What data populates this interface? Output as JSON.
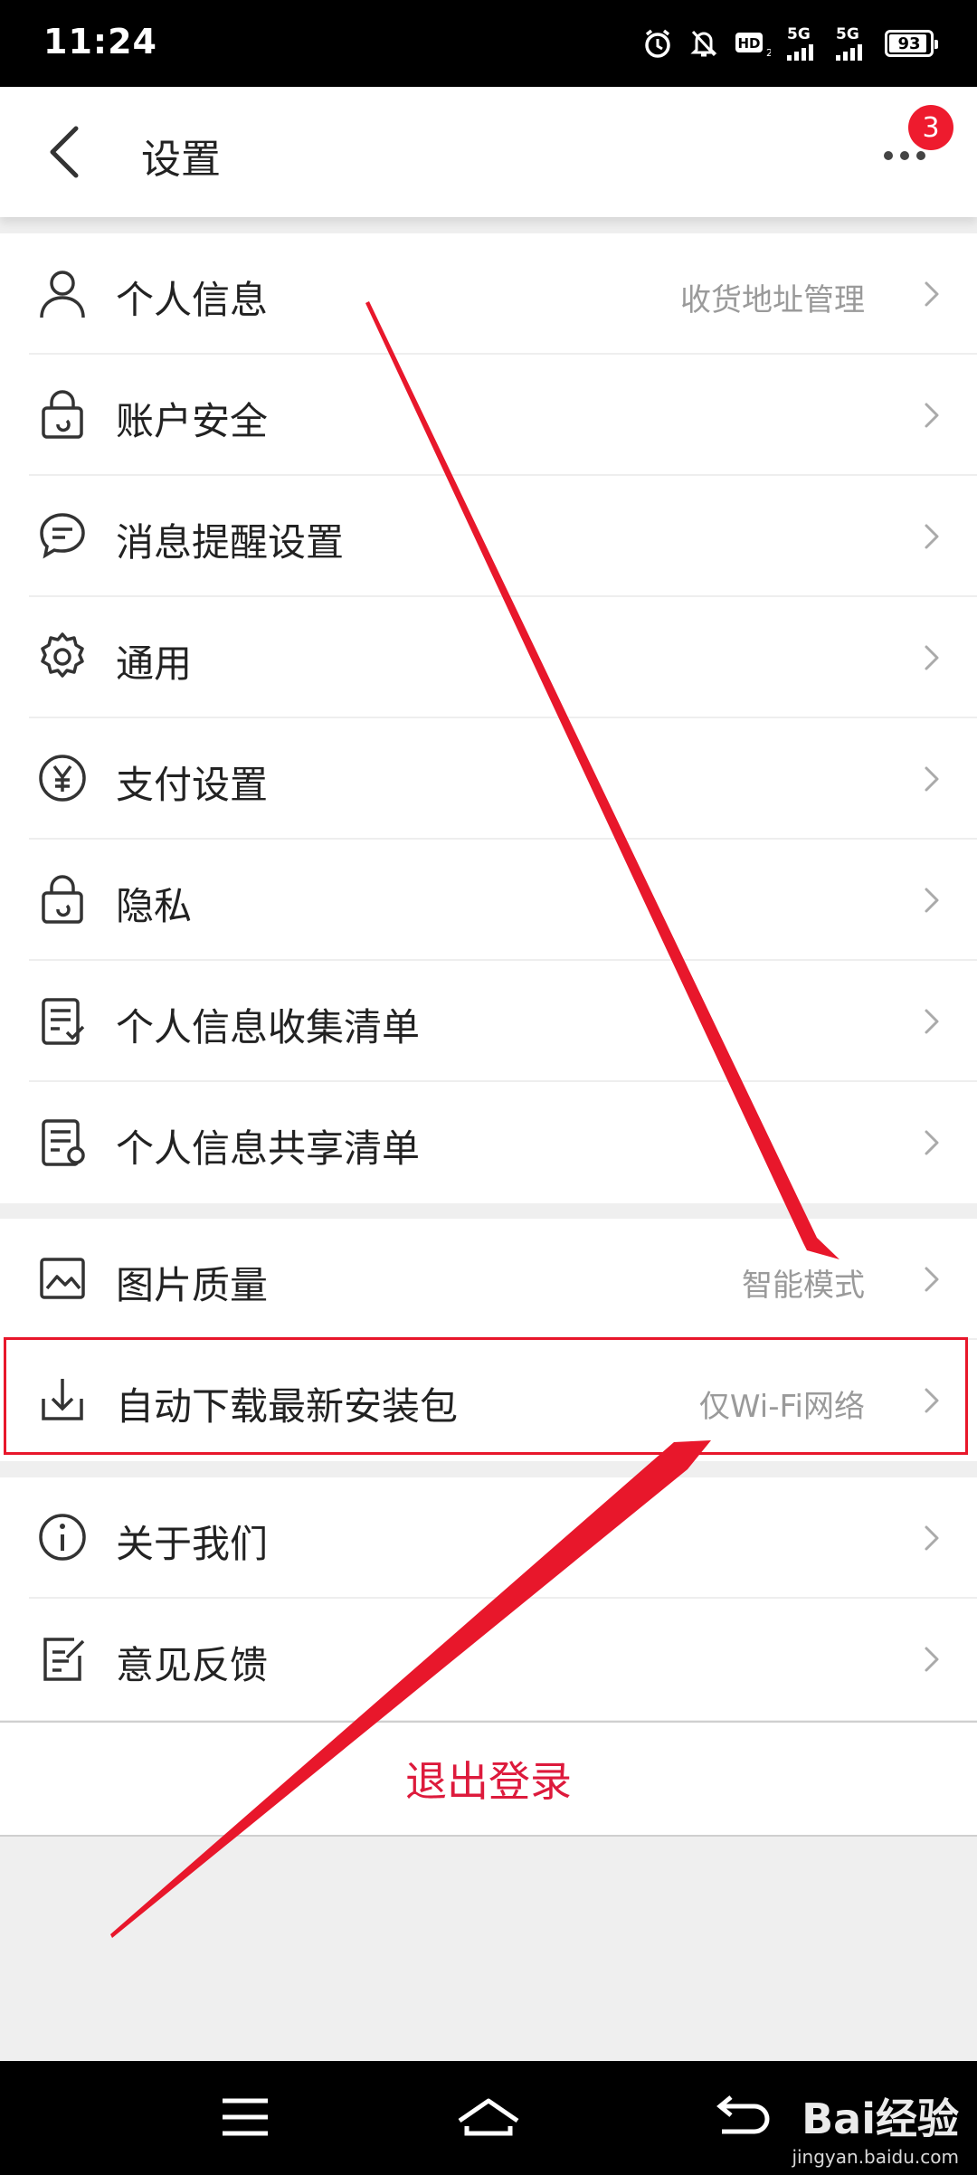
{
  "status_bar": {
    "time": "11:24",
    "network1": "5G",
    "network2": "5G",
    "hd_label": "HD",
    "battery": "93"
  },
  "header": {
    "title": "设置",
    "badge_count": "3"
  },
  "group1": [
    {
      "label": "个人信息",
      "value": "收货地址管理",
      "icon": "person-icon"
    },
    {
      "label": "账户安全",
      "value": "",
      "icon": "lock-icon"
    },
    {
      "label": "消息提醒设置",
      "value": "",
      "icon": "message-icon"
    },
    {
      "label": "通用",
      "value": "",
      "icon": "gear-icon"
    },
    {
      "label": "支付设置",
      "value": "",
      "icon": "yen-icon"
    },
    {
      "label": "隐私",
      "value": "",
      "icon": "lock-icon"
    },
    {
      "label": "个人信息收集清单",
      "value": "",
      "icon": "checklist-icon"
    },
    {
      "label": "个人信息共享清单",
      "value": "",
      "icon": "share-list-icon"
    }
  ],
  "group2": [
    {
      "label": "图片质量",
      "value": "智能模式",
      "icon": "image-icon"
    },
    {
      "label": "自动下载最新安装包",
      "value": "仅Wi-Fi网络",
      "icon": "download-icon"
    }
  ],
  "group3": [
    {
      "label": "关于我们",
      "value": "",
      "icon": "info-icon"
    },
    {
      "label": "意见反馈",
      "value": "",
      "icon": "feedback-icon"
    }
  ],
  "logout_label": "退出登录",
  "watermark": {
    "main": "Bai经验",
    "sub": "jingyan.baidu.com"
  },
  "colors": {
    "accent_red": "#dd1a3c",
    "badge_red": "#ee1b2e",
    "annotation_red": "#e8172b"
  }
}
